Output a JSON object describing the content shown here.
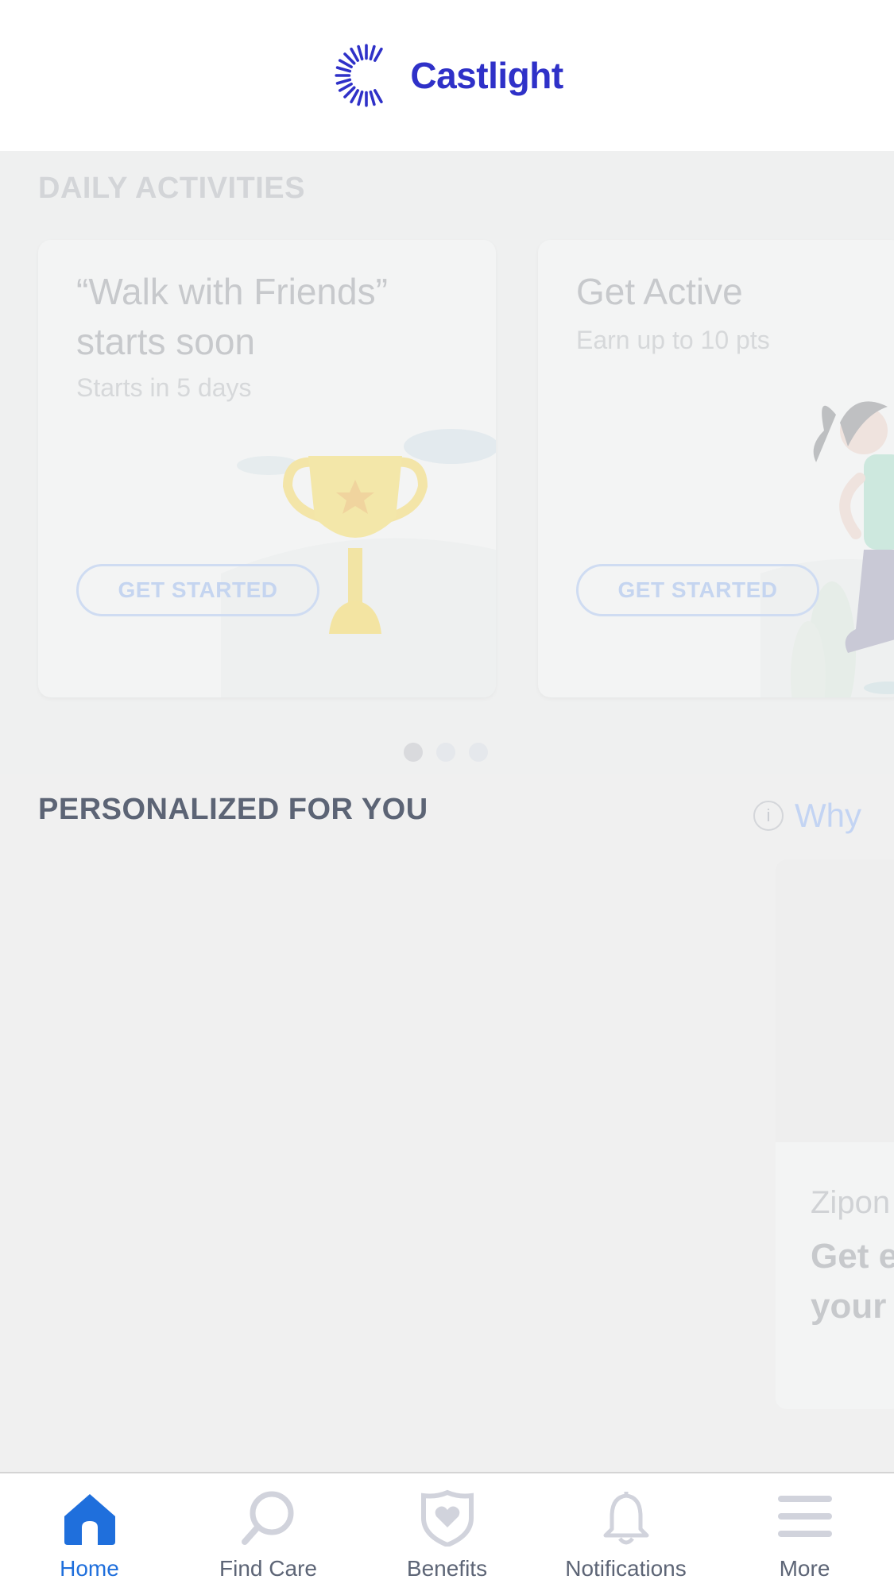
{
  "header": {
    "brand": "Castlight"
  },
  "daily": {
    "title": "DAILY ACTIVITIES",
    "cards": [
      {
        "title": "“Walk with Friends” starts soon",
        "subtitle": "Starts in 5 days",
        "button": "GET STARTED",
        "illustration": "trophy-icon"
      },
      {
        "title": "Get Active",
        "subtitle": "Earn up to 10 pts",
        "button": "GET STARTED",
        "illustration": "runner-illustration"
      }
    ],
    "pagination": {
      "pages": 3,
      "current": 1
    }
  },
  "personalized": {
    "title": "PERSONALIZED FOR YOU",
    "why_label": "Why",
    "card": {
      "source": "Zipon",
      "title_line1": "Get e",
      "title_line2": "your"
    }
  },
  "nav": {
    "items": [
      {
        "label": "Home",
        "icon": "home-icon",
        "active": true
      },
      {
        "label": "Find Care",
        "icon": "search-icon",
        "active": false
      },
      {
        "label": "Benefits",
        "icon": "shield-heart-icon",
        "active": false
      },
      {
        "label": "Notifications",
        "icon": "bell-icon",
        "active": false
      },
      {
        "label": "More",
        "icon": "menu-icon",
        "active": false
      }
    ]
  },
  "colors": {
    "brand": "#2f31c8",
    "active_nav": "#1f6fdc",
    "nav_inactive": "#5d6576"
  }
}
